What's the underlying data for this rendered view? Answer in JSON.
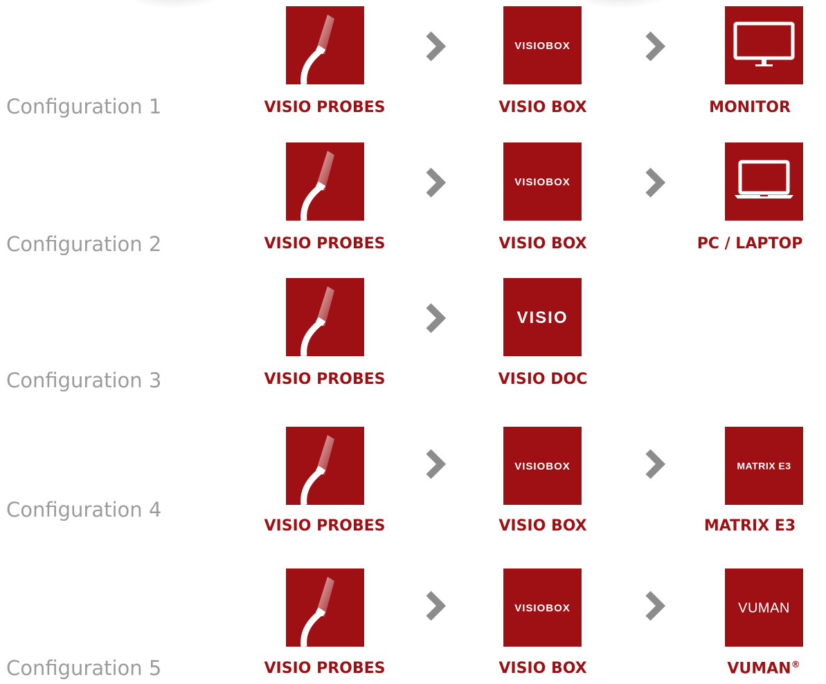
{
  "colors": {
    "brand_red": "#9e1013",
    "config_label_gray": "#9b9b9b",
    "arrow_gray": "#8c8c8c"
  },
  "configurations": [
    {
      "label": "Configuration 1",
      "nodes": [
        {
          "label": "VISIO PROBES",
          "icon": "probe-icon"
        },
        {
          "label": "VISIO BOX",
          "icon": "visio-box-logo",
          "logo_text": "VISIOBOX"
        },
        {
          "label": "MONITOR",
          "icon": "monitor-icon"
        }
      ]
    },
    {
      "label": "Configuration 2",
      "nodes": [
        {
          "label": "VISIO PROBES",
          "icon": "probe-icon"
        },
        {
          "label": "VISIO BOX",
          "icon": "visio-box-logo",
          "logo_text": "VISIOBOX"
        },
        {
          "label": "PC / LAPTOP",
          "icon": "laptop-icon"
        }
      ]
    },
    {
      "label": "Configuration 3",
      "nodes": [
        {
          "label": "VISIO PROBES",
          "icon": "probe-icon"
        },
        {
          "label": "VISIO DOC",
          "icon": "visio-logo",
          "logo_text": "VISIO"
        }
      ]
    },
    {
      "label": "Configuration 4",
      "nodes": [
        {
          "label": "VISIO PROBES",
          "icon": "probe-icon"
        },
        {
          "label": "VISIO BOX",
          "icon": "visio-box-logo",
          "logo_text": "VISIOBOX"
        },
        {
          "label": "MATRIX E3",
          "icon": "matrix-e3-logo",
          "logo_text": "MATRIX E3"
        }
      ]
    },
    {
      "label": "Configuration 5",
      "nodes": [
        {
          "label": "VISIO PROBES",
          "icon": "probe-icon"
        },
        {
          "label": "VISIO BOX",
          "icon": "visio-box-logo",
          "logo_text": "VISIOBOX"
        },
        {
          "label": "VUMAN",
          "label_suffix": "®",
          "icon": "vuman-logo",
          "logo_text": "VUMAN"
        }
      ]
    }
  ]
}
